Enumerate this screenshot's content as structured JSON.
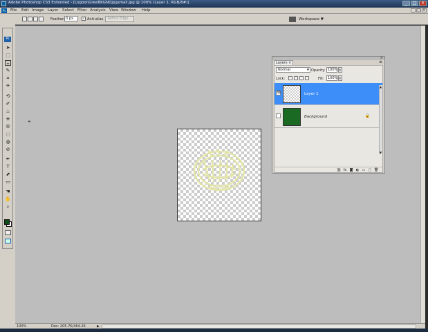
{
  "window": {
    "title": "Adobe Photoshop CS3 Extended - [LogoonGreeBKGNDjpgsmall.jpg @ 100% (Layer 1, RGB/8#)]",
    "controls": [
      "_",
      "□",
      "×"
    ]
  },
  "menubar": {
    "items": [
      "File",
      "Edit",
      "Image",
      "Layer",
      "Select",
      "Filter",
      "Analysis",
      "View",
      "Window",
      "Help"
    ],
    "doc_controls": [
      "_",
      "□",
      "×"
    ],
    "ps_label": "Ps"
  },
  "options": {
    "feather_label": "Feather:",
    "feather_value": "0 px",
    "antialias_label": "Anti-alias",
    "antialias_checked": "✓",
    "refine_edge_label": "Refine Edge...",
    "workspace_label": "Workspace ▼"
  },
  "toolbox": {
    "badge": "Ps",
    "tools": [
      "➤",
      "⬚",
      "⌖",
      "✎",
      "⌗",
      "✈",
      "⟲",
      "✐",
      "♨",
      "⎈",
      "✇",
      "◌",
      "◍",
      "⊘",
      "✒",
      "T",
      "⬈",
      "▭",
      "☚",
      "✋",
      "⌕"
    ],
    "foreground_color": "#0f4d18",
    "background_color": "#ffffff"
  },
  "layers_panel": {
    "tab_label": "Layers ×",
    "menu_icon": "≡",
    "blend_mode": "Normal",
    "opacity_label": "Opacity:",
    "opacity_value": "100%",
    "locks_label": "Lock:",
    "fill_label": "Fill:",
    "fill_value": "100%",
    "layers": [
      {
        "name": "Layer 1",
        "visible_icon": "👁",
        "active": true
      },
      {
        "name": "Background",
        "visible_icon": "",
        "active": false,
        "locked_icon": "🔒"
      }
    ],
    "footer_buttons": [
      "⛓",
      "fx",
      "◙",
      "◐",
      "▭",
      "▢",
      "🗑"
    ]
  },
  "status": {
    "zoom": "100%",
    "doc_info": "Doc: 205.7K/464.2K",
    "arrow": "▶"
  }
}
